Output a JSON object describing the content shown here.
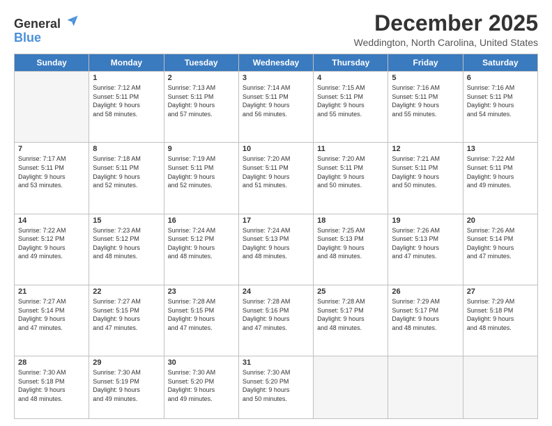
{
  "header": {
    "logo_line1": "General",
    "logo_line2": "Blue",
    "month": "December 2025",
    "location": "Weddington, North Carolina, United States"
  },
  "days_of_week": [
    "Sunday",
    "Monday",
    "Tuesday",
    "Wednesday",
    "Thursday",
    "Friday",
    "Saturday"
  ],
  "weeks": [
    [
      {
        "day": "",
        "info": ""
      },
      {
        "day": "1",
        "info": "Sunrise: 7:12 AM\nSunset: 5:11 PM\nDaylight: 9 hours\nand 58 minutes."
      },
      {
        "day": "2",
        "info": "Sunrise: 7:13 AM\nSunset: 5:11 PM\nDaylight: 9 hours\nand 57 minutes."
      },
      {
        "day": "3",
        "info": "Sunrise: 7:14 AM\nSunset: 5:11 PM\nDaylight: 9 hours\nand 56 minutes."
      },
      {
        "day": "4",
        "info": "Sunrise: 7:15 AM\nSunset: 5:11 PM\nDaylight: 9 hours\nand 55 minutes."
      },
      {
        "day": "5",
        "info": "Sunrise: 7:16 AM\nSunset: 5:11 PM\nDaylight: 9 hours\nand 55 minutes."
      },
      {
        "day": "6",
        "info": "Sunrise: 7:16 AM\nSunset: 5:11 PM\nDaylight: 9 hours\nand 54 minutes."
      }
    ],
    [
      {
        "day": "7",
        "info": "Sunrise: 7:17 AM\nSunset: 5:11 PM\nDaylight: 9 hours\nand 53 minutes."
      },
      {
        "day": "8",
        "info": "Sunrise: 7:18 AM\nSunset: 5:11 PM\nDaylight: 9 hours\nand 52 minutes."
      },
      {
        "day": "9",
        "info": "Sunrise: 7:19 AM\nSunset: 5:11 PM\nDaylight: 9 hours\nand 52 minutes."
      },
      {
        "day": "10",
        "info": "Sunrise: 7:20 AM\nSunset: 5:11 PM\nDaylight: 9 hours\nand 51 minutes."
      },
      {
        "day": "11",
        "info": "Sunrise: 7:20 AM\nSunset: 5:11 PM\nDaylight: 9 hours\nand 50 minutes."
      },
      {
        "day": "12",
        "info": "Sunrise: 7:21 AM\nSunset: 5:11 PM\nDaylight: 9 hours\nand 50 minutes."
      },
      {
        "day": "13",
        "info": "Sunrise: 7:22 AM\nSunset: 5:11 PM\nDaylight: 9 hours\nand 49 minutes."
      }
    ],
    [
      {
        "day": "14",
        "info": "Sunrise: 7:22 AM\nSunset: 5:12 PM\nDaylight: 9 hours\nand 49 minutes."
      },
      {
        "day": "15",
        "info": "Sunrise: 7:23 AM\nSunset: 5:12 PM\nDaylight: 9 hours\nand 48 minutes."
      },
      {
        "day": "16",
        "info": "Sunrise: 7:24 AM\nSunset: 5:12 PM\nDaylight: 9 hours\nand 48 minutes."
      },
      {
        "day": "17",
        "info": "Sunrise: 7:24 AM\nSunset: 5:13 PM\nDaylight: 9 hours\nand 48 minutes."
      },
      {
        "day": "18",
        "info": "Sunrise: 7:25 AM\nSunset: 5:13 PM\nDaylight: 9 hours\nand 48 minutes."
      },
      {
        "day": "19",
        "info": "Sunrise: 7:26 AM\nSunset: 5:13 PM\nDaylight: 9 hours\nand 47 minutes."
      },
      {
        "day": "20",
        "info": "Sunrise: 7:26 AM\nSunset: 5:14 PM\nDaylight: 9 hours\nand 47 minutes."
      }
    ],
    [
      {
        "day": "21",
        "info": "Sunrise: 7:27 AM\nSunset: 5:14 PM\nDaylight: 9 hours\nand 47 minutes."
      },
      {
        "day": "22",
        "info": "Sunrise: 7:27 AM\nSunset: 5:15 PM\nDaylight: 9 hours\nand 47 minutes."
      },
      {
        "day": "23",
        "info": "Sunrise: 7:28 AM\nSunset: 5:15 PM\nDaylight: 9 hours\nand 47 minutes."
      },
      {
        "day": "24",
        "info": "Sunrise: 7:28 AM\nSunset: 5:16 PM\nDaylight: 9 hours\nand 47 minutes."
      },
      {
        "day": "25",
        "info": "Sunrise: 7:28 AM\nSunset: 5:17 PM\nDaylight: 9 hours\nand 48 minutes."
      },
      {
        "day": "26",
        "info": "Sunrise: 7:29 AM\nSunset: 5:17 PM\nDaylight: 9 hours\nand 48 minutes."
      },
      {
        "day": "27",
        "info": "Sunrise: 7:29 AM\nSunset: 5:18 PM\nDaylight: 9 hours\nand 48 minutes."
      }
    ],
    [
      {
        "day": "28",
        "info": "Sunrise: 7:30 AM\nSunset: 5:18 PM\nDaylight: 9 hours\nand 48 minutes."
      },
      {
        "day": "29",
        "info": "Sunrise: 7:30 AM\nSunset: 5:19 PM\nDaylight: 9 hours\nand 49 minutes."
      },
      {
        "day": "30",
        "info": "Sunrise: 7:30 AM\nSunset: 5:20 PM\nDaylight: 9 hours\nand 49 minutes."
      },
      {
        "day": "31",
        "info": "Sunrise: 7:30 AM\nSunset: 5:20 PM\nDaylight: 9 hours\nand 50 minutes."
      },
      {
        "day": "",
        "info": ""
      },
      {
        "day": "",
        "info": ""
      },
      {
        "day": "",
        "info": ""
      }
    ]
  ]
}
